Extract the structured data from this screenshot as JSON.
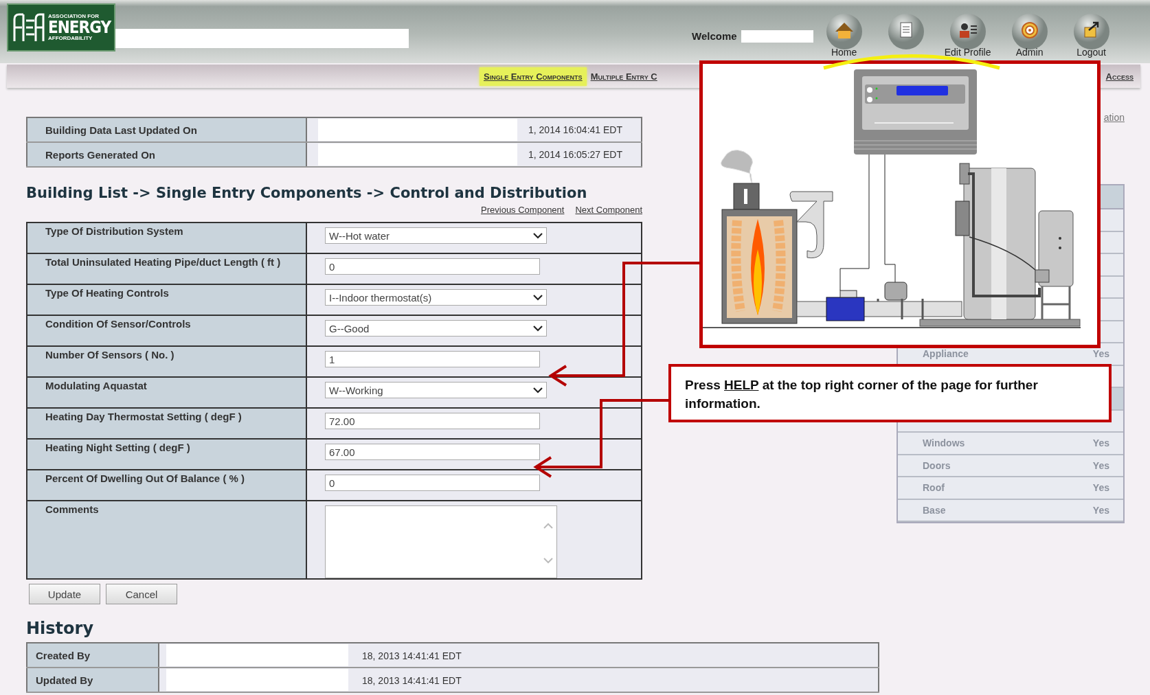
{
  "header": {
    "logo": {
      "line_top": "ASSOCIATION FOR",
      "line_main": "ENERGY",
      "line_bottom": "AFFORDABILITY"
    },
    "welcome_label": "Welcome",
    "nav_icons": [
      {
        "kind": "home",
        "label": "Home"
      },
      {
        "kind": "document"
      },
      {
        "kind": "profile",
        "label": "Edit Profile"
      },
      {
        "kind": "admin",
        "label": "Admin"
      },
      {
        "kind": "logout",
        "label": "Logout"
      }
    ]
  },
  "menu": [
    {
      "label": "Single Entry Components",
      "selected": true
    },
    {
      "label": "Multiple Entry C",
      "selected": false
    },
    {
      "label": "Access",
      "selected": false
    }
  ],
  "info_table": [
    {
      "label": "Building Data Last Updated On",
      "value": "1, 2014 16:04:41 EDT"
    },
    {
      "label": "Reports Generated On",
      "value": "1, 2014 16:05:27 EDT"
    }
  ],
  "breadcrumb": "Building List -> Single Entry Components -> Control and Distribution",
  "component_links": [
    "Previous Component",
    "Next Component"
  ],
  "form": [
    {
      "label": "Type Of Distribution System",
      "kind": "select",
      "value": "W--Hot water"
    },
    {
      "label": "Total Uninsulated Heating Pipe/duct Length ( ft )",
      "kind": "text",
      "value": "0"
    },
    {
      "label": "Type Of Heating Controls",
      "kind": "select",
      "value": "I--Indoor thermostat(s)"
    },
    {
      "label": "Condition Of Sensor/Controls",
      "kind": "select",
      "value": "G--Good"
    },
    {
      "label": "Number Of Sensors ( No. )",
      "kind": "text",
      "value": "1"
    },
    {
      "label": "Modulating Aquastat",
      "kind": "select",
      "value": "W--Working"
    },
    {
      "label": "Heating Day Thermostat Setting ( degF )",
      "kind": "text",
      "value": "72.00"
    },
    {
      "label": "Heating Night Setting ( degF )",
      "kind": "text",
      "value": "67.00"
    },
    {
      "label": "Percent Of Dwelling Out Of Balance ( % )",
      "kind": "text",
      "value": "0"
    },
    {
      "label": "Comments",
      "kind": "textarea"
    }
  ],
  "buttons": [
    "Update",
    "Cancel"
  ],
  "history": {
    "title": "History",
    "rows": [
      {
        "label": "Created By",
        "value": "18, 2013 14:41:41 EDT"
      },
      {
        "label": "Updated By",
        "value": "18, 2013 14:41:41 EDT"
      }
    ]
  },
  "side_panel": {
    "link": "ation",
    "rows": [
      {
        "selected": false
      },
      {
        "selected": false
      },
      {
        "selected": false
      },
      {
        "selected": false
      },
      {
        "selected": false
      },
      {
        "selected": false
      },
      {
        "label": "Appliance",
        "value": "Yes",
        "selected": false
      },
      {
        "selected": false
      },
      {
        "selected": true
      },
      {
        "selected": false
      },
      {
        "label": "Windows",
        "value": "Yes",
        "selected": false
      },
      {
        "label": "Doors",
        "value": "Yes",
        "selected": false
      },
      {
        "label": "Roof",
        "value": "Yes",
        "selected": false
      },
      {
        "label": "Base",
        "value": "Yes",
        "selected": false
      }
    ]
  },
  "callout": {
    "text_before": "Press",
    "emphasis": "HELP",
    "text_after": "at the top right corner of the page for further information."
  }
}
